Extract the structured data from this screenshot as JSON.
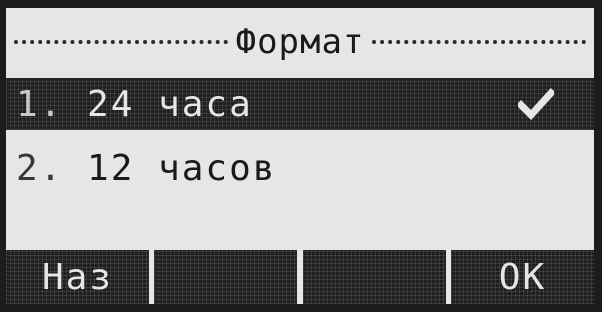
{
  "screen": {
    "title": "Формат"
  },
  "list": {
    "items": [
      {
        "index": "1.",
        "label": "24 часа",
        "selected": true,
        "icon": "checkmark-icon"
      },
      {
        "index": "2.",
        "label": "12 часов",
        "selected": false
      }
    ]
  },
  "softkeys": {
    "back_label": "Наз",
    "key2_label": "",
    "key3_label": "",
    "ok_label": "OK"
  },
  "colors": {
    "screen_bg": "#e6e6e4",
    "highlight_bg": "#1f1f1f",
    "text_dark": "#1a1a1a",
    "text_light": "#e6e6e4"
  }
}
